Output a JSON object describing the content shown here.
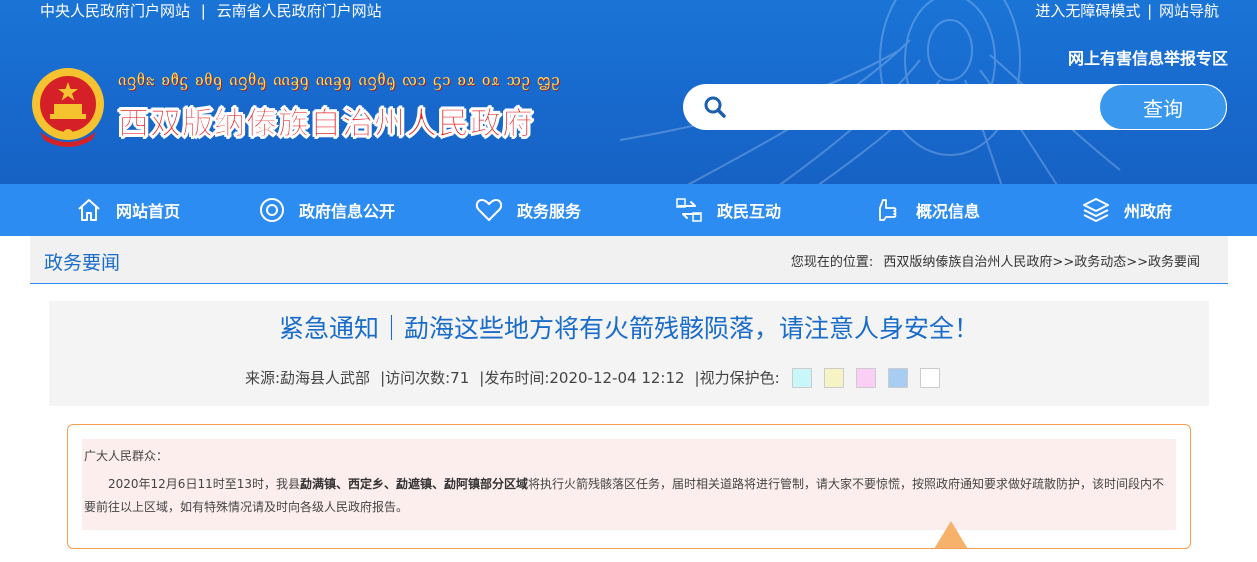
{
  "header": {
    "top_left_links": [
      "中央人民政府门户网站",
      "云南省人民政府门户网站"
    ],
    "top_left_sep": "|",
    "top_right_links": [
      "进入无障碍模式",
      "网站导航"
    ],
    "top_right_sep": "|",
    "report_link": "网上有害信息举报专区",
    "dai_script": "ᦵᦋᦲᦰ ᦈᦹᧃ ᦈᦲᧁ ᦵᦋᦲᧂ ᦶᦃᧁ ᦶᦃᧁ ᦵᦋᦲᧂ ᦟᦱ ᦓᦱ ᦈᦸ ᦞᦸ ᦉᦳ ᦗᦳ",
    "site_title": "西双版纳傣族自治州人民政府",
    "search_placeholder": "",
    "search_button": "查询"
  },
  "nav": {
    "items": [
      {
        "label": "网站首页",
        "icon": "home-icon"
      },
      {
        "label": "政府信息公开",
        "icon": "target-icon"
      },
      {
        "label": "政务服务",
        "icon": "heart-icon"
      },
      {
        "label": "政民互动",
        "icon": "exchange-icon"
      },
      {
        "label": "概况信息",
        "icon": "hand-icon"
      },
      {
        "label": "州政府",
        "icon": "layers-icon"
      }
    ]
  },
  "section": {
    "title": "政务要闻",
    "breadcrumb_prefix": "您现在的位置:",
    "breadcrumb": "西双版纳傣族自治州人民政府>>政务动态>>政务要闻"
  },
  "article": {
    "title": "紧急通知｜勐海这些地方将有火箭残骸陨落，请注意人身安全！",
    "source": "来源:勐海县人武部",
    "visits": "|访问次数:71",
    "published": "|发布时间:2020-12-04 12:12",
    "eye_care": "|视力保护色:",
    "eye_colors": [
      "#c9f6f9",
      "#f6f4c4",
      "#fbcff5",
      "#a8cdf5",
      "#ffffff"
    ]
  },
  "notice": {
    "greeting": "广大人民群众：",
    "body_pre": "2020年12月6日11时至13时，我县",
    "body_bold": "勐满镇、西定乡、勐遮镇、勐阿镇部分区域",
    "body_post": "将执行火箭残骸落区任务，届时相关道路将进行管制，请大家不要惊慌，按照政府通知要求做好疏散防护，该时间段内不要前往以上区域，如有特殊情况请及时向各级人民政府报告。"
  }
}
